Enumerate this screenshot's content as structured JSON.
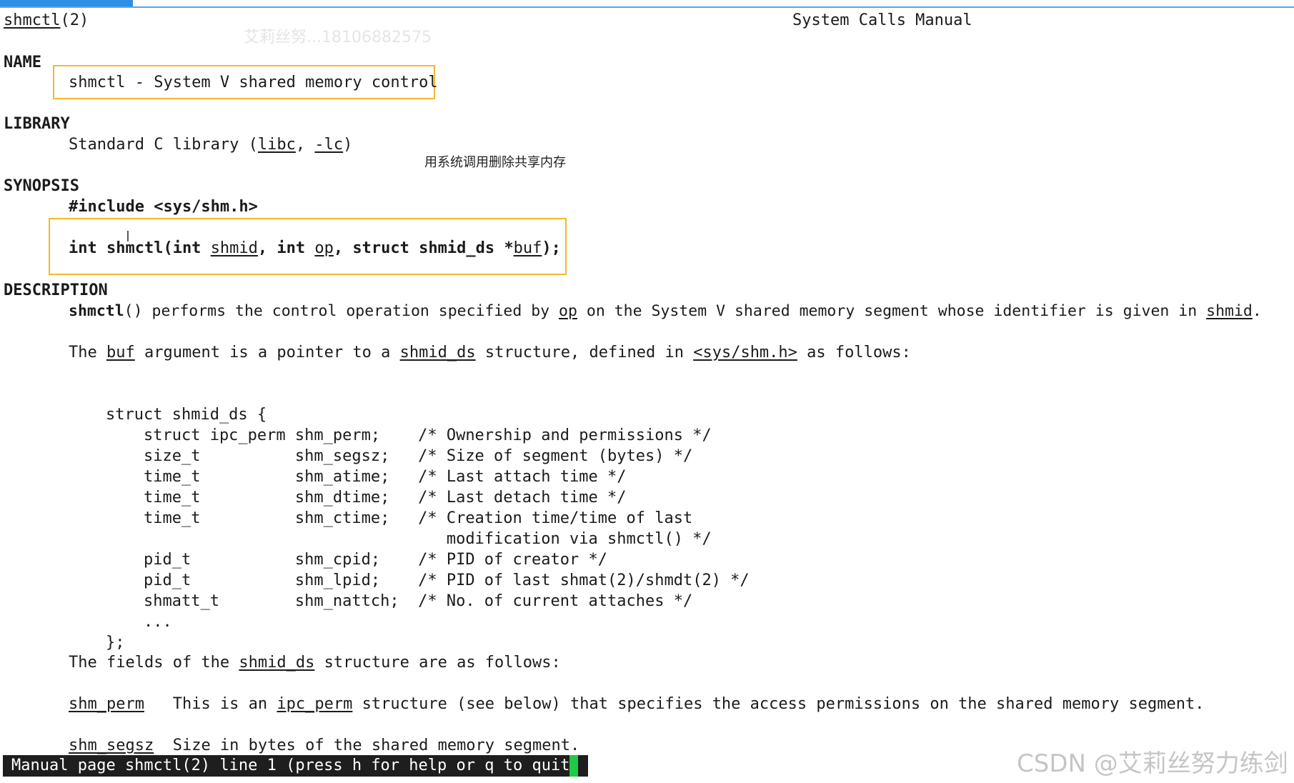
{
  "header": {
    "left_name": "shmctl",
    "left_section": "(2)",
    "right": "System Calls Manual"
  },
  "watermark_top": "艾莉丝努...18106882575",
  "sections": {
    "name": "NAME",
    "library": "LIBRARY",
    "synopsis": "SYNOPSIS",
    "description": "DESCRIPTION"
  },
  "name_line": "shmctl - System V shared memory control",
  "library": {
    "text1": "Standard C library (",
    "libc": "libc",
    "comma": ", ",
    "lc": "-lc",
    "end": ")"
  },
  "annotation": "用系统调用删除共享内存",
  "synopsis": {
    "include": "#include <sys/shm.h>",
    "p1": "int shmctl(int ",
    "shmid": "shmid",
    "p2": ", int ",
    "op": "op",
    "p3": ", struct shmid_ds *",
    "buf": "buf",
    "p4": ");"
  },
  "desc1": {
    "fn": "shmctl",
    "t1": "() performs the control operation specified by ",
    "op": "op",
    "t2": " on the System V shared memory segment whose identifier is given in ",
    "shmid": "shmid",
    "t3": "."
  },
  "desc2": {
    "t1": "The ",
    "buf": "buf",
    "t2": " argument is a pointer to a ",
    "shmid_ds": "shmid_ds",
    "t3": " structure, defined in ",
    "hdr": "<sys/shm.h>",
    "t4": " as follows:"
  },
  "struct_lines": [
    "struct shmid_ds {",
    "    struct ipc_perm shm_perm;    /* Ownership and permissions */",
    "    size_t          shm_segsz;   /* Size of segment (bytes) */",
    "    time_t          shm_atime;   /* Last attach time */",
    "    time_t          shm_dtime;   /* Last detach time */",
    "    time_t          shm_ctime;   /* Creation time/time of last",
    "                                    modification via shmctl() */",
    "    pid_t           shm_cpid;    /* PID of creator */",
    "    pid_t           shm_lpid;    /* PID of last shmat(2)/shmdt(2) */",
    "    shmatt_t        shm_nattch;  /* No. of current attaches */",
    "    ...",
    "};"
  ],
  "fields_intro": {
    "t1": "The fields of the ",
    "shmid_ds": "shmid_ds",
    "t2": " structure are as follows:"
  },
  "field_perm": {
    "name": "shm_perm",
    "t1": "   This is an ",
    "ipc": "ipc_perm",
    "t2": " structure (see below) that specifies the access permissions on the shared memory segment."
  },
  "field_segsz": {
    "name": "shm_segsz",
    "t1": "  Size in bytes of the shared memory segment."
  },
  "status": "Manual page shmctl(2) line 1 (press h for help or q to quit)",
  "csdn_watermark": "CSDN @艾莉丝努力练剑"
}
